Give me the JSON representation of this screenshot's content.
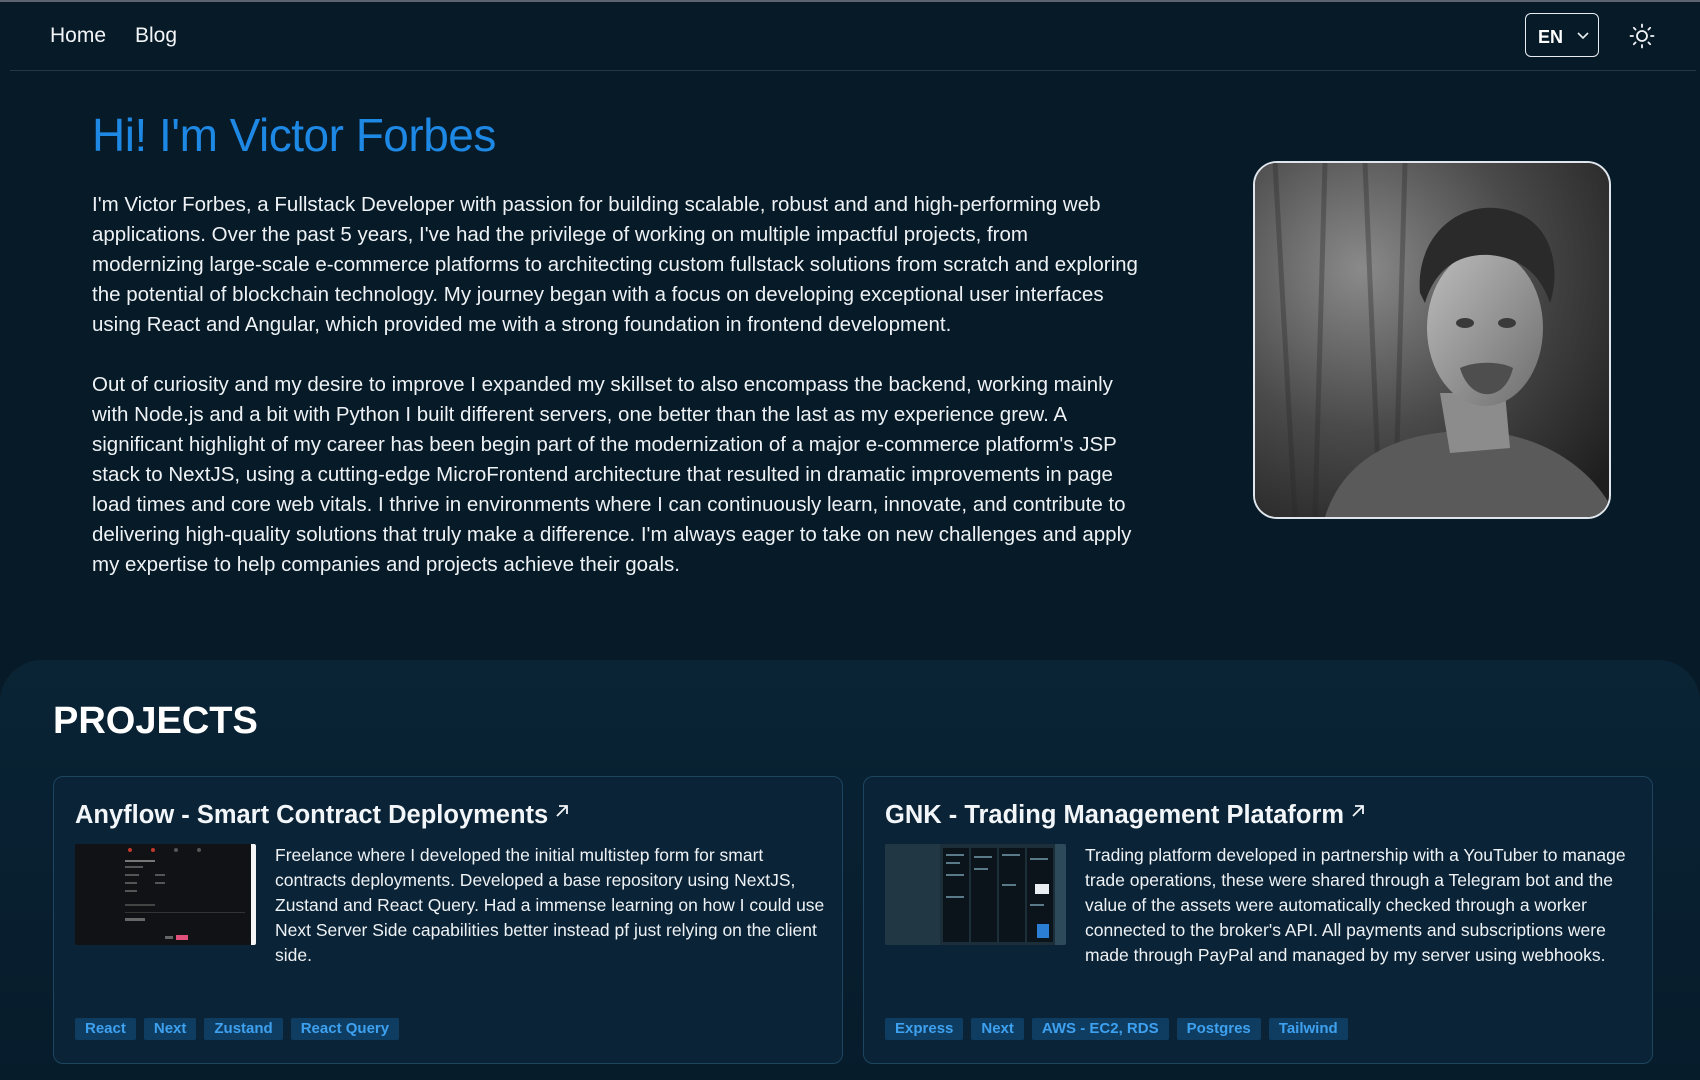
{
  "nav": {
    "links": [
      "Home",
      "Blog"
    ],
    "language": "EN"
  },
  "hero": {
    "title": "Hi! I'm Victor Forbes",
    "bio_paragraph_1": "I'm Victor Forbes, a Fullstack Developer with passion for building scalable, robust and and high-performing web applications. Over the past 5 years, I've had the privilege of working on multiple impactful projects, from modernizing large-scale e-commerce platforms to architecting custom fullstack solutions from scratch and exploring the potential of blockchain technology. My journey began with a focus on developing exceptional user interfaces using React and Angular, which provided me with a strong foundation in frontend development.",
    "bio_paragraph_2": "Out of curiosity and my desire to improve I expanded my skillset to also encompass the backend, working mainly with Node.js and a bit with Python I built different servers, one better than the last as my experience grew. A significant highlight of my career has been begin part of the modernization of a major e-commerce platform's JSP stack to NextJS, using a cutting-edge MicroFrontend architecture that resulted in dramatic improvements in page load times and core web vitals. I thrive in environments where I can continuously learn, innovate, and contribute to delivering high-quality solutions that truly make a difference. I'm always eager to take on new challenges and apply my expertise to help companies and projects achieve their goals."
  },
  "projects": {
    "heading": "PROJECTS",
    "items": [
      {
        "title": "Anyflow - Smart Contract Deployments",
        "description": "Freelance where I developed the initial multistep form for smart contracts deployments. Developed a base repository using NextJS, Zustand and React Query. Had a immense learning on how I could use Next Server Side capabilities better instead pf just relying on the client side.",
        "tags": [
          "React",
          "Next",
          "Zustand",
          "React Query"
        ]
      },
      {
        "title": "GNK - Trading Management Plataform",
        "description": "Trading platform developed in partnership with a YouTuber to manage trade operations, these were shared through a Telegram bot and the value of the assets were automatically checked through a worker connected to the broker's API. All payments and subscriptions were made through PayPal and managed by my server using webhooks.",
        "tags": [
          "Express",
          "Next",
          "AWS - EC2, RDS",
          "Postgres",
          "Tailwind"
        ]
      }
    ]
  },
  "colors": {
    "background": "#071a27",
    "accent": "#1e88e5",
    "tag_bg": "#0f3d62",
    "tag_text": "#3ea1f0"
  }
}
